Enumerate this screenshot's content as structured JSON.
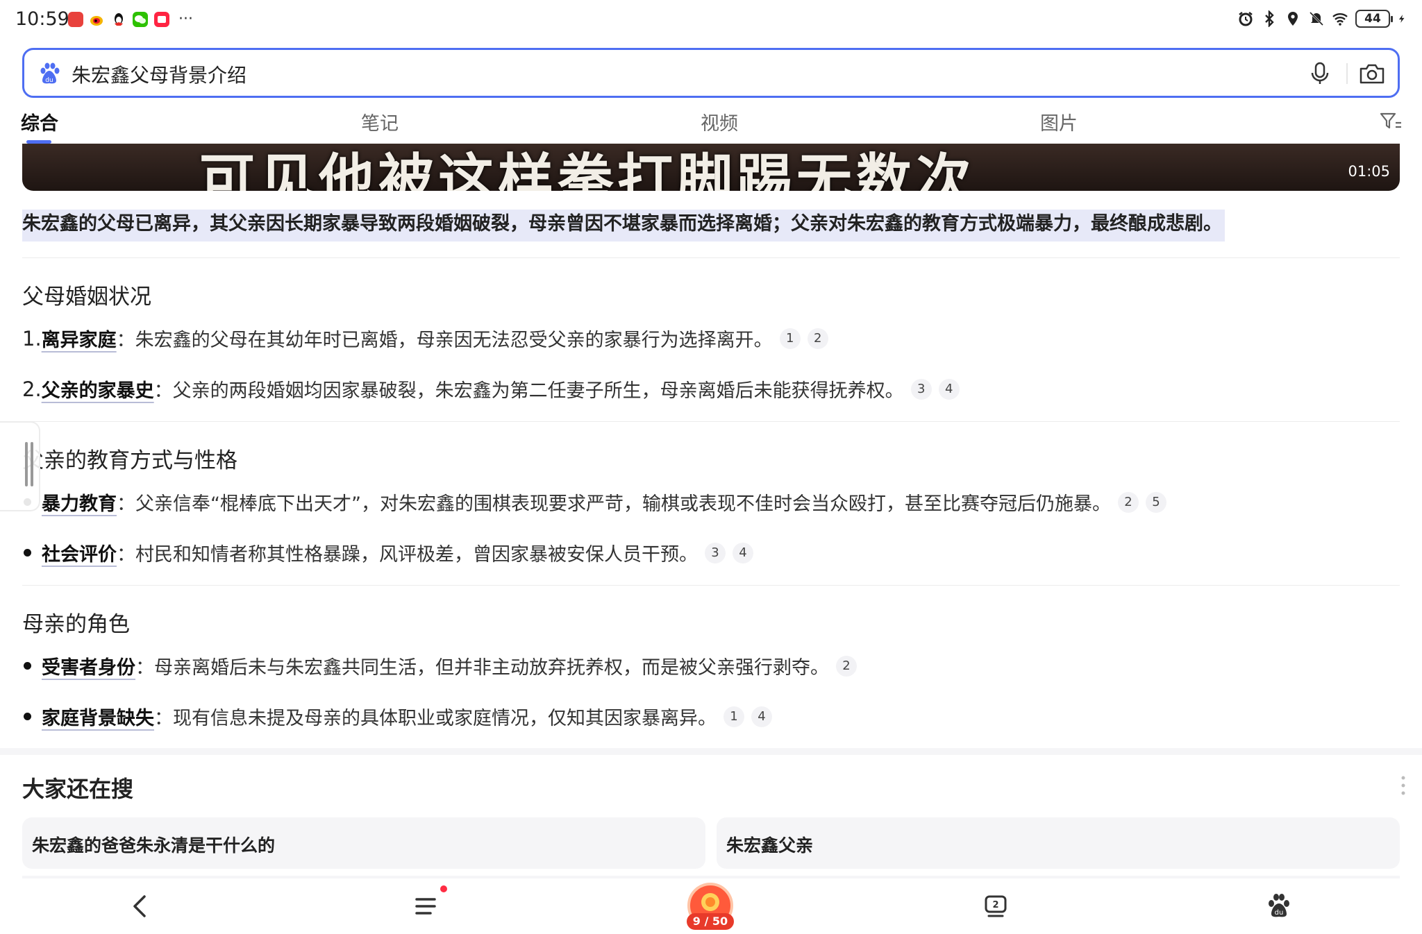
{
  "status_bar": {
    "time": "10:59",
    "apps": [
      "red-app-icon",
      "weibo-icon",
      "qq-icon",
      "wechat-icon",
      "red-square-icon"
    ],
    "more": "···",
    "battery": "44"
  },
  "search": {
    "query": "朱宏鑫父母背景介绍"
  },
  "tabs": [
    {
      "label": "综合",
      "active": true
    },
    {
      "label": "笔记",
      "active": false
    },
    {
      "label": "视频",
      "active": false
    },
    {
      "label": "图片",
      "active": false
    }
  ],
  "video": {
    "caption": "可见他被这样拳打脚踢无数次",
    "duration": "01:05"
  },
  "answer": {
    "summary": "朱宏鑫的父母已离异，其父亲因长期家暴导致两段婚姻破裂，母亲曾因不堪家暴而选择离婚；父亲对朱宏鑫的教育方式极端暴力，最终酿成悲剧。",
    "sections": [
      {
        "title": "父母婚姻状况",
        "items": [
          {
            "marker": "1.",
            "key": "离异家庭",
            "text": "：朱宏鑫的父母在其幼年时已离婚，母亲因无法忍受父亲的家暴行为选择离开。",
            "cites": [
              "1",
              "2"
            ]
          },
          {
            "marker": "2.",
            "key": "父亲的家暴史",
            "text": "：父亲的两段婚姻均因家暴破裂，朱宏鑫为第二任妻子所生，母亲离婚后未能获得抚养权。",
            "cites": [
              "3",
              "4"
            ]
          }
        ]
      },
      {
        "title": "父亲的教育方式与性格",
        "items": [
          {
            "marker": "•",
            "key": "暴力教育",
            "text": "：父亲信奉“棍棒底下出天才”，对朱宏鑫的围棋表现要求严苛，输棋或表现不佳时会当众殴打，甚至比赛夺冠后仍施暴。",
            "cites": [
              "2",
              "5"
            ]
          },
          {
            "marker": "•",
            "key": "社会评价",
            "text": "：村民和知情者称其性格暴躁，风评极差，曾因家暴被安保人员干预。",
            "cites": [
              "3",
              "4"
            ]
          }
        ]
      },
      {
        "title": "母亲的角色",
        "items": [
          {
            "marker": "•",
            "key": "受害者身份",
            "text": "：母亲离婚后未与朱宏鑫共同生活，但并非主动放弃抚养权，而是被父亲强行剥夺。",
            "cites": [
              "2"
            ]
          },
          {
            "marker": "•",
            "key": "家庭背景缺失",
            "text": "：现有信息未提及母亲的具体职业或家庭情况，仅知其因家暴离异。",
            "cites": [
              "1",
              "4"
            ]
          }
        ]
      }
    ]
  },
  "related": {
    "title": "大家还在搜",
    "items": [
      "朱宏鑫的爸爸朱永清是干什么的",
      "朱宏鑫父亲"
    ]
  },
  "bottom_nav": {
    "center_label": "9 / 50",
    "tabs_count": "2"
  },
  "colors": {
    "accent": "#4e6ef2",
    "highlight": "#e7e9f8",
    "badge": "#ff2c43"
  }
}
